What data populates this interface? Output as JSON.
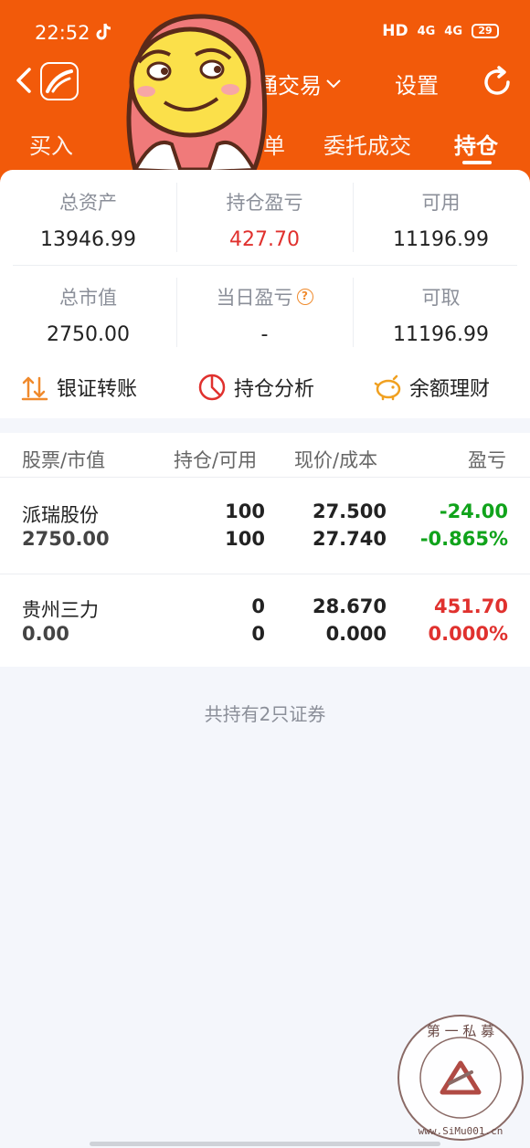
{
  "status_bar": {
    "time": "22:52",
    "hd": "HD",
    "signal1": "4G",
    "signal2": "4G",
    "battery": "29"
  },
  "nav": {
    "account_title": "通交易",
    "settings": "设置"
  },
  "tabs": [
    "买入",
    "单",
    "委托成交",
    "持仓"
  ],
  "active_tab": "持仓",
  "summary": {
    "total_assets": {
      "label": "总资产",
      "value": "13946.99"
    },
    "position_pnl": {
      "label": "持仓盈亏",
      "value": "427.70"
    },
    "available": {
      "label": "可用",
      "value": "11196.99"
    },
    "market_value": {
      "label": "总市值",
      "value": "2750.00"
    },
    "daily_pnl": {
      "label": "当日盈亏",
      "value": "-"
    },
    "withdrawable": {
      "label": "可取",
      "value": "11196.99"
    }
  },
  "shortcuts": {
    "bank_transfer": "银证转账",
    "position_analysis": "持仓分析",
    "balance_finance": "余额理财"
  },
  "holdings_header": {
    "stock": "股票/市值",
    "qty": "持仓/可用",
    "price": "现价/成本",
    "pnl": "盈亏"
  },
  "holdings": [
    {
      "name": "派瑞股份",
      "market_value": "2750.00",
      "position": "100",
      "available": "100",
      "price": "27.500",
      "cost": "27.740",
      "pnl": "-24.00",
      "pnl_pct": "-0.865%"
    },
    {
      "name": "贵州三力",
      "market_value": "0.00",
      "position": "0",
      "available": "0",
      "price": "28.670",
      "cost": "0.000",
      "pnl": "451.70",
      "pnl_pct": "0.000%"
    }
  ],
  "footer_note": "共持有2只证券",
  "colors": {
    "brand_orange": "#f25a0a",
    "loss_green": "#10a31b",
    "gain_red": "#e0312e"
  }
}
